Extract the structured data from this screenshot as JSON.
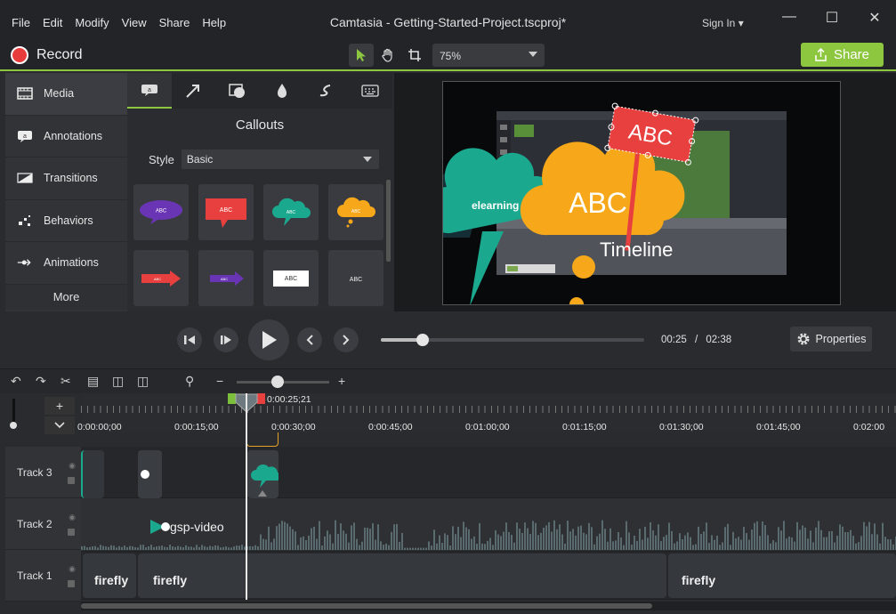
{
  "menu": [
    "File",
    "Edit",
    "Modify",
    "View",
    "Share",
    "Help"
  ],
  "app_title": "Camtasia - Getting-Started-Project.tscproj*",
  "sign_in": "Sign In ▾",
  "window_controls": [
    "minimize-icon",
    "maximize-icon",
    "close-icon"
  ],
  "toolbar": {
    "record_label": "Record",
    "zoom_value": "75%",
    "share_label": "Share"
  },
  "sidebar": {
    "items": [
      {
        "label": "Media",
        "icon": "film-icon"
      },
      {
        "label": "Annotations",
        "icon": "annotation-icon"
      },
      {
        "label": "Transitions",
        "icon": "transition-icon"
      },
      {
        "label": "Behaviors",
        "icon": "behaviors-icon"
      },
      {
        "label": "Animations",
        "icon": "animation-icon"
      }
    ],
    "more_label": "More"
  },
  "panel": {
    "title": "Callouts",
    "style_label": "Style",
    "style_value": "Basic",
    "tabs": [
      "callout-tab-icon",
      "arrow-tab-icon",
      "shape-tab-icon",
      "blur-tab-icon",
      "sketch-tab-icon",
      "keyboard-tab-icon"
    ],
    "callout_text": "ABC"
  },
  "preview": {
    "cloud_text_1": "elearning",
    "cloud_text_2": "ABC",
    "sign_text": "ABC",
    "timeline_text": "Timeline"
  },
  "playback": {
    "current_time": "00:25",
    "separator": "/",
    "total_time": "02:38",
    "progress": 0.16,
    "properties_label": "Properties"
  },
  "timeline": {
    "playhead_time": "0:00:25;21",
    "ruler_labels": [
      "0:00:00;00",
      "0:00:15;00",
      "0:00:30;00",
      "0:00:45;00",
      "0:01:00;00",
      "0:01:15;00",
      "0:01:30;00",
      "0:01:45;00",
      "0:02:00"
    ],
    "tracks": [
      {
        "name": "Track 3"
      },
      {
        "name": "Track 2",
        "clip": "gsp-video"
      },
      {
        "name": "Track 1",
        "clips": [
          "firefly",
          "firefly",
          "firefly"
        ]
      }
    ]
  },
  "colors": {
    "accent_green": "#8dc63f",
    "record_red": "#e83c3c",
    "cloud_teal": "#1aa98f",
    "cloud_orange": "#f6a81a",
    "sign_red": "#e8403f"
  }
}
